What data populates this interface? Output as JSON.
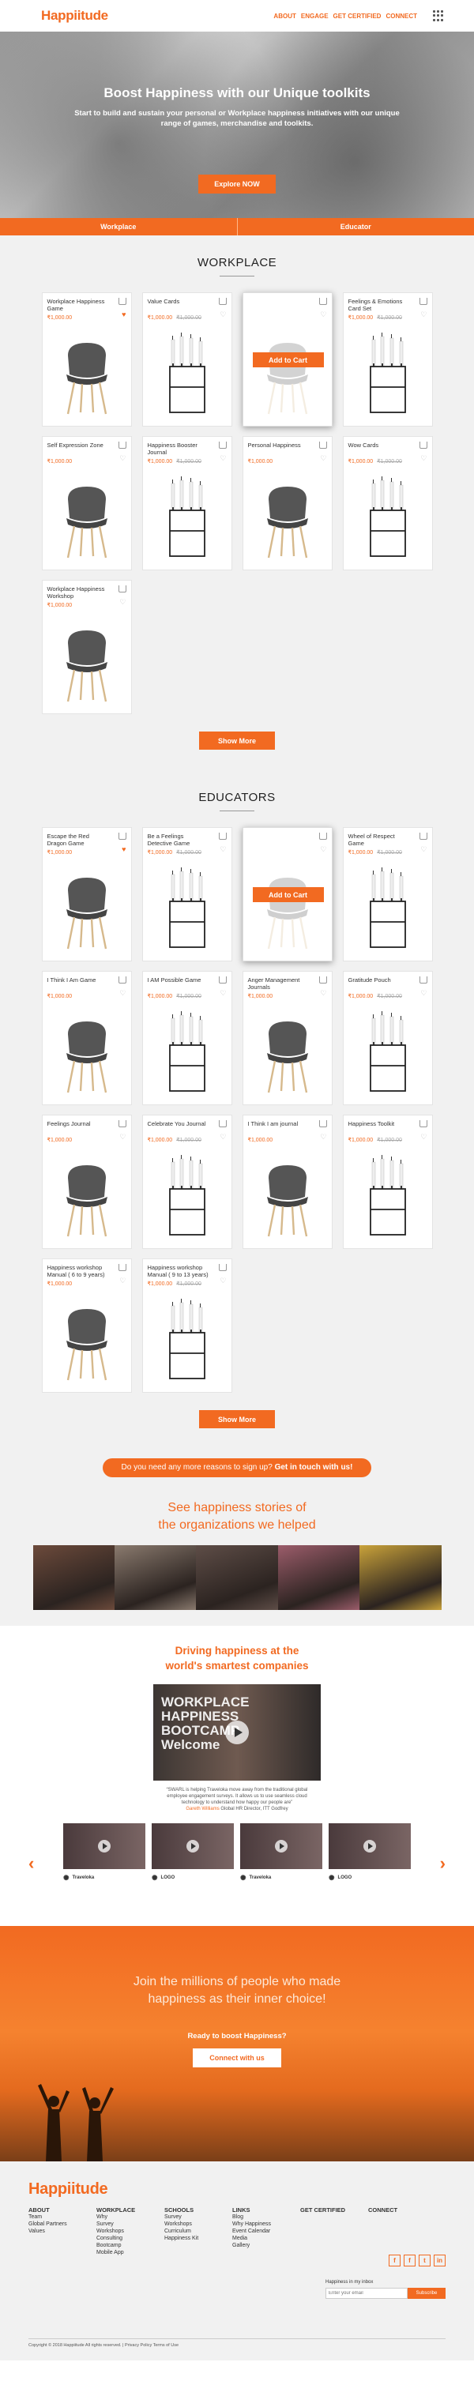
{
  "header": {
    "logo": "Happiitude",
    "nav": [
      "ABOUT",
      "ENGAGE",
      "GET CERTIFIED",
      "CONNECT"
    ]
  },
  "hero": {
    "title": "Boost Happiness with our Unique toolkits",
    "subtitle": "Start to build and sustain your personal or Workplace happiness initiatives with our unique range of games, merchandise and toolkits.",
    "button": "Explore NOW"
  },
  "tabs": [
    "Workplace",
    "Educator"
  ],
  "workplace": {
    "title": "WORKPLACE",
    "more": "Show More",
    "cards": [
      {
        "title": "Workplace Happiness Game",
        "price": "₹1,000.00",
        "old": "",
        "img": "chair",
        "heart": true
      },
      {
        "title": "Value Cards",
        "price": "₹1,000.00",
        "old": "₹1,000.00",
        "img": "candles",
        "heart": false
      },
      {
        "title": "",
        "price": "",
        "old": "",
        "img": "chair",
        "heart": false,
        "hover": true,
        "add": "Add to Cart"
      },
      {
        "title": "Feelings & Emotions Card Set",
        "price": "₹1,000.00",
        "old": "₹1,000.00",
        "img": "candles",
        "heart": false
      },
      {
        "title": "Self Expression Zone",
        "price": "₹1,000.00",
        "old": "",
        "img": "chair",
        "heart": false
      },
      {
        "title": "Happiness Booster Journal",
        "price": "₹1,000.00",
        "old": "₹1,000.00",
        "img": "candles",
        "heart": false
      },
      {
        "title": "Personal Happiness",
        "price": "₹1,000.00",
        "old": "",
        "img": "chair",
        "heart": false
      },
      {
        "title": "Wow Cards",
        "price": "₹1,000.00",
        "old": "₹1,000.00",
        "img": "candles",
        "heart": false
      },
      {
        "title": "Workplace Happiness Workshop",
        "price": "₹1,000.00",
        "old": "",
        "img": "chair",
        "heart": false
      }
    ]
  },
  "educators": {
    "title": "EDUCATORS",
    "more": "Show More",
    "cards": [
      {
        "title": "Escape the Red Dragon Game",
        "price": "₹1,000.00",
        "old": "",
        "img": "chair",
        "heart": true
      },
      {
        "title": "Be a Feelings Detective Game",
        "price": "₹1,000.00",
        "old": "₹1,000.00",
        "img": "candles",
        "heart": false
      },
      {
        "title": "",
        "price": "",
        "old": "",
        "img": "chair",
        "heart": false,
        "hover": true,
        "add": "Add to Cart"
      },
      {
        "title": "Wheel of Respect Game",
        "price": "₹1,000.00",
        "old": "₹1,000.00",
        "img": "candles",
        "heart": false
      },
      {
        "title": "I Think I Am Game",
        "price": "₹1,000.00",
        "old": "",
        "img": "chair",
        "heart": false
      },
      {
        "title": "I AM Possible Game",
        "price": "₹1,000.00",
        "old": "₹1,000.00",
        "img": "candles",
        "heart": false
      },
      {
        "title": "Anger Management Journals",
        "price": "₹1,000.00",
        "old": "",
        "img": "chair",
        "heart": false
      },
      {
        "title": "Gratitude Pouch",
        "price": "₹1,000.00",
        "old": "₹1,000.00",
        "img": "candles",
        "heart": false
      },
      {
        "title": "Feelings Journal",
        "price": "₹1,000.00",
        "old": "",
        "img": "chair",
        "heart": false
      },
      {
        "title": "Celebrate You Journal",
        "price": "₹1,000.00",
        "old": "₹1,000.00",
        "img": "candles",
        "heart": false
      },
      {
        "title": "I Think I am journal",
        "price": "₹1,000.00",
        "old": "",
        "img": "chair",
        "heart": false
      },
      {
        "title": "Happiness Toolkit",
        "price": "₹1,000.00",
        "old": "₹1,000.00",
        "img": "candles",
        "heart": false
      },
      {
        "title": "Happiness workshop Manual ( 6 to 9 years)",
        "price": "₹1,000.00",
        "old": "",
        "img": "chair",
        "heart": false
      },
      {
        "title": "Happiness workshop Manual ( 9 to 13 years)",
        "price": "₹1,000.00",
        "old": "₹1,000.00",
        "img": "candles",
        "heart": false
      }
    ]
  },
  "cta": {
    "text": "Do you need any more reasons to sign up?",
    "bold": "Get in touch with us!"
  },
  "stories": {
    "line1": "See happiness stories of",
    "line2": "the organizations we helped",
    "photo_colors": [
      "#6c4a3b",
      "#8a7a6e",
      "#5e4d47",
      "#9b5c6a",
      "#c9a23a"
    ]
  },
  "drive": {
    "line1": "Driving happiness at the",
    "line2": "world's smartest companies",
    "video_text": "WORKPLACE HAPPINESS BOOTCAMP Welcome",
    "quote": "“SWARL is helping Traveloka move away from the traditional global employee engagement surveys. It allows us to use seamless cloud technology to understand how happy our people are”",
    "author": "Gareth Williams",
    "author_role": "Global HR Director, ITT Godfrey",
    "thumbs": [
      {
        "label": "Traveloka"
      },
      {
        "label": "LOGO"
      },
      {
        "label": "Traveloka"
      },
      {
        "label": "LOGO"
      }
    ],
    "prev": "‹",
    "next": "›"
  },
  "join": {
    "line1": "Join the millions of people who made",
    "line2": "happiness as their inner choice!",
    "ready": "Ready to boost Happiness?",
    "button": "Connect with us"
  },
  "footer": {
    "logo": "Happiitude",
    "cols": [
      {
        "title": "ABOUT",
        "items": [
          "Team",
          "Global Partners",
          "Values"
        ]
      },
      {
        "title": "WORKPLACE",
        "items": [
          "Why",
          "Survey",
          "Workshops",
          "Consulting",
          "Bootcamp",
          "Mobile App"
        ]
      },
      {
        "title": "SCHOOLS",
        "items": [
          "Survey",
          "Workshops",
          "Curriculum",
          "Happiness Kit"
        ]
      },
      {
        "title": "LINKS",
        "items": [
          "Blog",
          "Why Happiness",
          "Event Calendar",
          "Media",
          "Gallery"
        ]
      },
      {
        "title": "GET CERTIFIED",
        "items": []
      },
      {
        "title": "CONNECT",
        "items": []
      }
    ],
    "social": [
      "f",
      "f",
      "t",
      "in"
    ],
    "newsletter_label": "Happiness in my inbox",
    "newsletter_placeholder": "Enter your email",
    "subscribe": "Subscribe",
    "copyright": "Copyright © 2018 Happiitude All rights reserved.  |  Privacy Policy  Terms of Use"
  }
}
